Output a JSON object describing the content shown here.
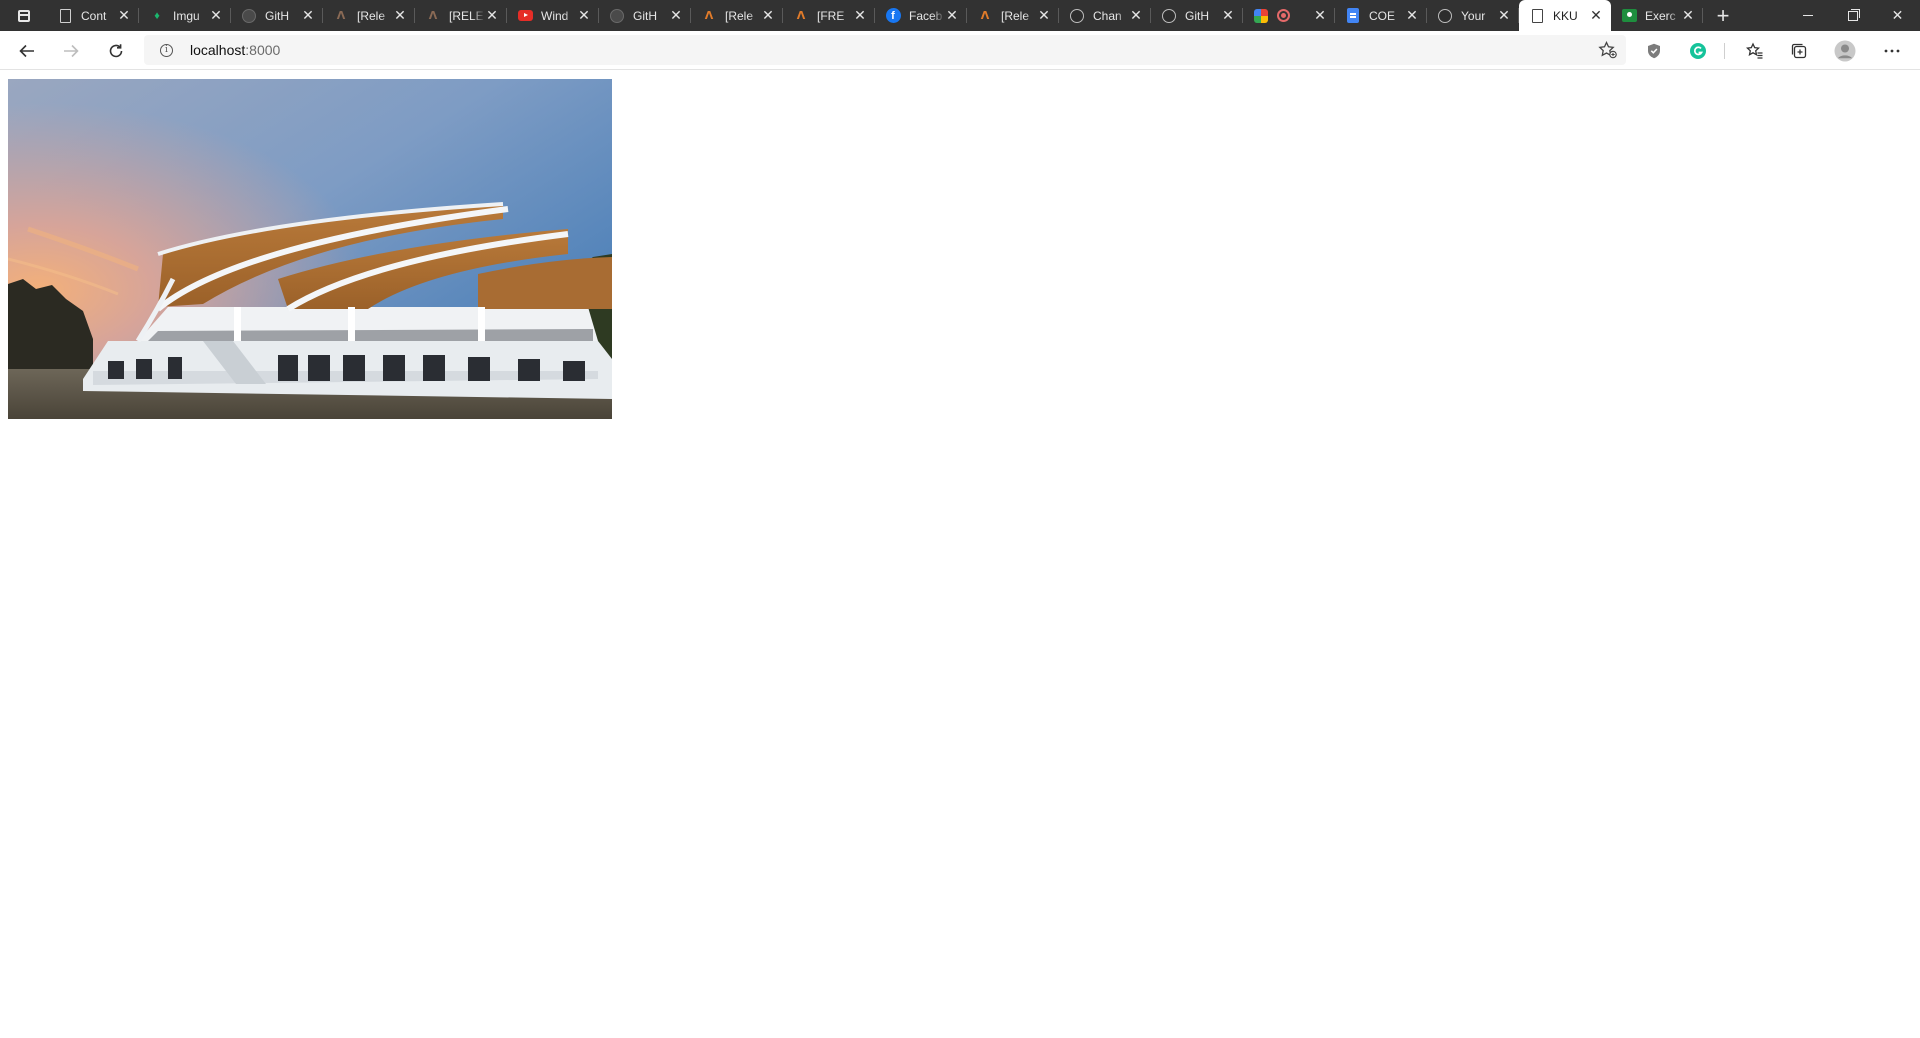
{
  "browser": {
    "tabs": [
      {
        "title": "Cont",
        "icon": "page-icon"
      },
      {
        "title": "Imgu",
        "icon": "imgur-icon"
      },
      {
        "title": "GitH",
        "icon": "github-icon"
      },
      {
        "title": "[Rele",
        "icon": "artstation-icon"
      },
      {
        "title": "[RELE",
        "icon": "artstation-icon"
      },
      {
        "title": "Wind",
        "icon": "youtube-icon"
      },
      {
        "title": "GitH",
        "icon": "github-icon"
      },
      {
        "title": "[Rele",
        "icon": "artstation-icon"
      },
      {
        "title": "[FRE",
        "icon": "artstation-icon"
      },
      {
        "title": "Faceb",
        "icon": "facebook-icon"
      },
      {
        "title": "[Rele",
        "icon": "artstation-icon"
      },
      {
        "title": "Chan",
        "icon": "github-icon"
      },
      {
        "title": "GitH",
        "icon": "github-icon"
      },
      {
        "title": "",
        "icon": "google-multicolor-icon"
      },
      {
        "title": "COE",
        "icon": "docs-icon"
      },
      {
        "title": "Your",
        "icon": "github-icon"
      },
      {
        "title": "KKU",
        "icon": "page-icon",
        "active": true
      },
      {
        "title": "Exerc",
        "icon": "classroom-icon"
      }
    ],
    "address": {
      "host": "localhost",
      "port": ":8000"
    }
  },
  "colors": {
    "tabstrip": "#323232",
    "active_tab": "#ffffff",
    "grammarly": "#15c39a",
    "artstation": "#e07b2a"
  },
  "content": {
    "image_subject": "KKU auditorium building with curved orange roofs at sunset"
  }
}
